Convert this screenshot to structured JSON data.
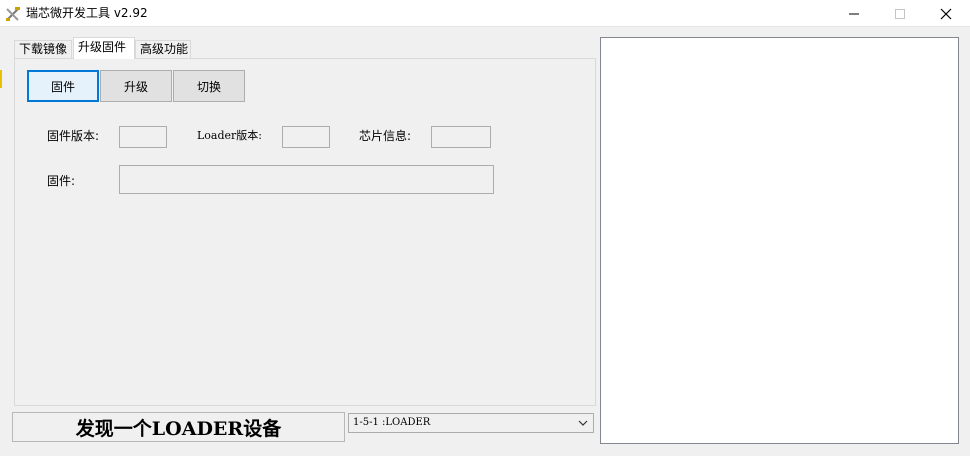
{
  "window": {
    "title": "瑞芯微开发工具 v2.92",
    "icon": "tools-icon",
    "controls": {
      "minimize": "minimize-icon",
      "maximize": "maximize-icon",
      "close": "close-icon"
    }
  },
  "tabs": [
    {
      "label": "下载镜像"
    },
    {
      "label": "升级固件",
      "active": true
    },
    {
      "label": "高级功能"
    }
  ],
  "buttons": {
    "firmware": "固件",
    "upgrade": "升级",
    "switch": "切换"
  },
  "fields": {
    "firmware_version_label": "固件版本:",
    "firmware_version_value": "",
    "loader_version_label": "Loader版本:",
    "loader_version_value": "",
    "chip_info_label": "芯片信息:",
    "chip_info_value": "",
    "firmware_path_label": "固件:",
    "firmware_path_value": ""
  },
  "status": {
    "text": "发现一个LOADER设备"
  },
  "device_select": {
    "selected": "1-5-1 :LOADER"
  },
  "colors": {
    "focus_border": "#0078d7",
    "window_bg": "#f0f0f0",
    "log_bg": "#ffffff"
  }
}
